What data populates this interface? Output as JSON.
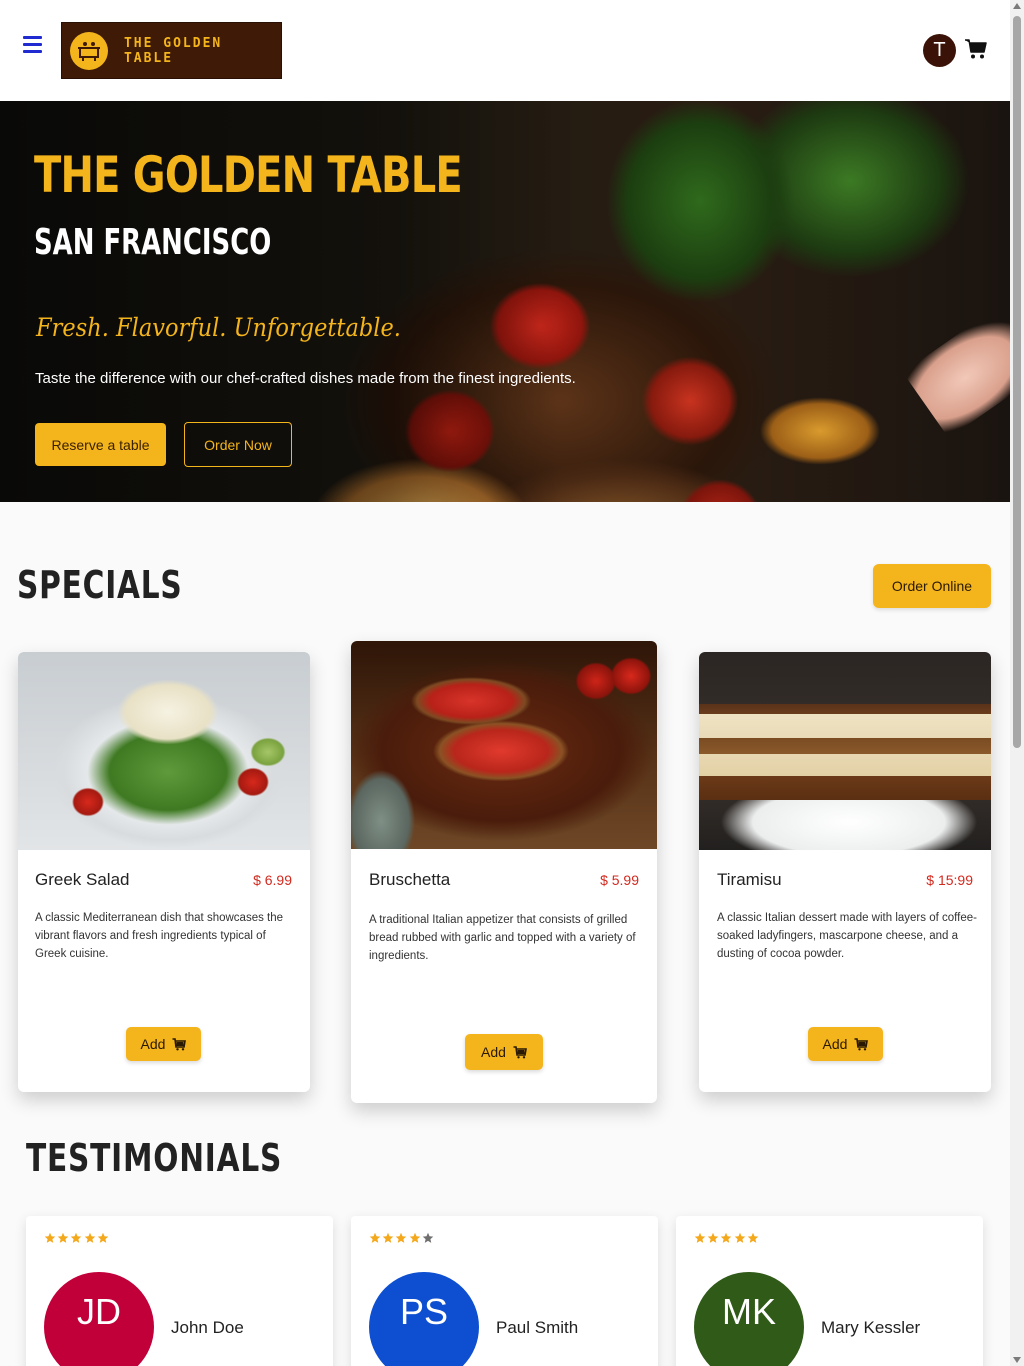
{
  "header": {
    "brand": "THE GOLDEN TABLE",
    "user_initial": "T",
    "icons": {
      "menu": "hamburger-menu-icon",
      "cart": "shopping-cart-icon",
      "logo": "dining-table-icon"
    },
    "colors": {
      "menu": "#1f2bd0",
      "logo_bg": "#3f1a06",
      "accent": "#f4b41c"
    }
  },
  "hero": {
    "title": "THE GOLDEN TABLE",
    "subtitle": "SAN FRANCISCO",
    "tagline": "Fresh. Flavorful. Unforgettable.",
    "description": "Taste the difference with our chef-crafted dishes made from the finest ingredients.",
    "reserve_label": "Reserve a table",
    "order_label": "Order Now"
  },
  "specials": {
    "title": "SPECIALS",
    "order_online_label": "Order Online",
    "items": [
      {
        "name": "Greek Salad",
        "price": "$ 6.99",
        "description": "A classic Mediterranean dish that showcases the vibrant flavors and fresh ingredients typical of Greek cuisine.",
        "add_label": "Add"
      },
      {
        "name": "Bruschetta",
        "price": "$ 5.99",
        "description": "A traditional Italian appetizer that consists of grilled bread rubbed with garlic and topped with a variety of ingredients.",
        "add_label": "Add"
      },
      {
        "name": "Tiramisu",
        "price": "$ 15:99",
        "description": "A classic Italian dessert made with layers of coffee-soaked ladyfingers, mascarpone cheese, and a dusting of cocoa powder.",
        "add_label": "Add"
      }
    ]
  },
  "testimonials": {
    "title": "TESTIMONIALS",
    "items": [
      {
        "initials": "JD",
        "name": "John Doe",
        "rating": 5,
        "color": "#c1003a"
      },
      {
        "initials": "PS",
        "name": "Paul Smith",
        "rating": 4,
        "color": "#0d4fd0"
      },
      {
        "initials": "MK",
        "name": "Mary Kessler",
        "rating": 5,
        "color": "#2f5a17"
      }
    ]
  }
}
